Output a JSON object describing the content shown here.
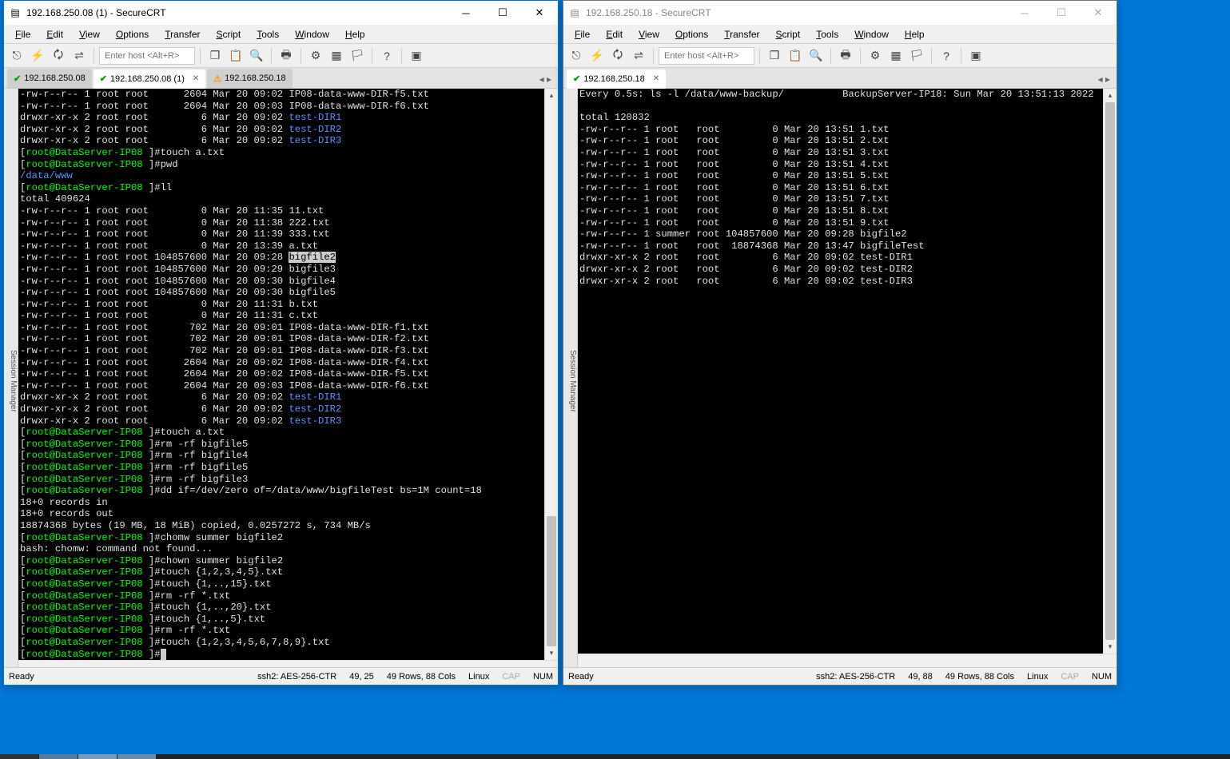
{
  "window1": {
    "title": "192.168.250.08 (1) - SecureCRT",
    "menus": [
      "File",
      "Edit",
      "View",
      "Options",
      "Transfer",
      "Script",
      "Tools",
      "Window",
      "Help"
    ],
    "host_placeholder": "Enter host <Alt+R>",
    "tabs": [
      {
        "label": "192.168.250.08",
        "icon": "check"
      },
      {
        "label": "192.168.250.08 (1)",
        "icon": "check",
        "active": true
      },
      {
        "label": "192.168.250.18",
        "icon": "warn"
      }
    ],
    "session_mgr_label": "Session Manager",
    "status": {
      "ready": "Ready",
      "conn": "ssh2: AES-256-CTR",
      "pos": "49,  25",
      "size": "49 Rows, 88 Cols",
      "os": "Linux",
      "caps": "CAP",
      "num": "NUM"
    },
    "prompt_user": "root@DataServer-IP08",
    "lines": [
      {
        "t": "file",
        "perm": "-rw-r--r--",
        "n": "1",
        "o": "root",
        "g": "root",
        "s": "2604",
        "d": "Mar 20 09:02",
        "f": "IP08-data-www-DIR-f5.txt"
      },
      {
        "t": "file",
        "perm": "-rw-r--r--",
        "n": "1",
        "o": "root",
        "g": "root",
        "s": "2604",
        "d": "Mar 20 09:03",
        "f": "IP08-data-www-DIR-f6.txt"
      },
      {
        "t": "dir",
        "perm": "drwxr-xr-x",
        "n": "2",
        "o": "root",
        "g": "root",
        "s": "6",
        "d": "Mar 20 09:02",
        "f": "test-DIR1"
      },
      {
        "t": "dir",
        "perm": "drwxr-xr-x",
        "n": "2",
        "o": "root",
        "g": "root",
        "s": "6",
        "d": "Mar 20 09:02",
        "f": "test-DIR2"
      },
      {
        "t": "dir",
        "perm": "drwxr-xr-x",
        "n": "2",
        "o": "root",
        "g": "root",
        "s": "6",
        "d": "Mar 20 09:02",
        "f": "test-DIR3"
      },
      {
        "t": "prompt",
        "cmd": "touch a.txt"
      },
      {
        "t": "prompt",
        "cmd": "pwd"
      },
      {
        "t": "out-blue",
        "text": "/data/www"
      },
      {
        "t": "prompt",
        "cmd": "ll"
      },
      {
        "t": "out",
        "text": "total 409624"
      },
      {
        "t": "file",
        "perm": "-rw-r--r--",
        "n": "1",
        "o": "root",
        "g": "root",
        "s": "0",
        "d": "Mar 20 11:35",
        "f": "11.txt"
      },
      {
        "t": "file",
        "perm": "-rw-r--r--",
        "n": "1",
        "o": "root",
        "g": "root",
        "s": "0",
        "d": "Mar 20 11:38",
        "f": "222.txt"
      },
      {
        "t": "file",
        "perm": "-rw-r--r--",
        "n": "1",
        "o": "root",
        "g": "root",
        "s": "0",
        "d": "Mar 20 11:39",
        "f": "333.txt"
      },
      {
        "t": "file",
        "perm": "-rw-r--r--",
        "n": "1",
        "o": "root",
        "g": "root",
        "s": "0",
        "d": "Mar 20 13:39",
        "f": "a.txt"
      },
      {
        "t": "file",
        "perm": "-rw-r--r--",
        "n": "1",
        "o": "root",
        "g": "root",
        "s": "104857600",
        "d": "Mar 20 09:28",
        "f": "bigfile2",
        "hl": true
      },
      {
        "t": "file",
        "perm": "-rw-r--r--",
        "n": "1",
        "o": "root",
        "g": "root",
        "s": "104857600",
        "d": "Mar 20 09:29",
        "f": "bigfile3"
      },
      {
        "t": "file",
        "perm": "-rw-r--r--",
        "n": "1",
        "o": "root",
        "g": "root",
        "s": "104857600",
        "d": "Mar 20 09:30",
        "f": "bigfile4"
      },
      {
        "t": "file",
        "perm": "-rw-r--r--",
        "n": "1",
        "o": "root",
        "g": "root",
        "s": "104857600",
        "d": "Mar 20 09:30",
        "f": "bigfile5"
      },
      {
        "t": "file",
        "perm": "-rw-r--r--",
        "n": "1",
        "o": "root",
        "g": "root",
        "s": "0",
        "d": "Mar 20 11:31",
        "f": "b.txt"
      },
      {
        "t": "file",
        "perm": "-rw-r--r--",
        "n": "1",
        "o": "root",
        "g": "root",
        "s": "0",
        "d": "Mar 20 11:31",
        "f": "c.txt"
      },
      {
        "t": "file",
        "perm": "-rw-r--r--",
        "n": "1",
        "o": "root",
        "g": "root",
        "s": "702",
        "d": "Mar 20 09:01",
        "f": "IP08-data-www-DIR-f1.txt"
      },
      {
        "t": "file",
        "perm": "-rw-r--r--",
        "n": "1",
        "o": "root",
        "g": "root",
        "s": "702",
        "d": "Mar 20 09:01",
        "f": "IP08-data-www-DIR-f2.txt"
      },
      {
        "t": "file",
        "perm": "-rw-r--r--",
        "n": "1",
        "o": "root",
        "g": "root",
        "s": "702",
        "d": "Mar 20 09:01",
        "f": "IP08-data-www-DIR-f3.txt"
      },
      {
        "t": "file",
        "perm": "-rw-r--r--",
        "n": "1",
        "o": "root",
        "g": "root",
        "s": "2604",
        "d": "Mar 20 09:02",
        "f": "IP08-data-www-DIR-f4.txt"
      },
      {
        "t": "file",
        "perm": "-rw-r--r--",
        "n": "1",
        "o": "root",
        "g": "root",
        "s": "2604",
        "d": "Mar 20 09:02",
        "f": "IP08-data-www-DIR-f5.txt"
      },
      {
        "t": "file",
        "perm": "-rw-r--r--",
        "n": "1",
        "o": "root",
        "g": "root",
        "s": "2604",
        "d": "Mar 20 09:03",
        "f": "IP08-data-www-DIR-f6.txt"
      },
      {
        "t": "dir",
        "perm": "drwxr-xr-x",
        "n": "2",
        "o": "root",
        "g": "root",
        "s": "6",
        "d": "Mar 20 09:02",
        "f": "test-DIR1"
      },
      {
        "t": "dir",
        "perm": "drwxr-xr-x",
        "n": "2",
        "o": "root",
        "g": "root",
        "s": "6",
        "d": "Mar 20 09:02",
        "f": "test-DIR2"
      },
      {
        "t": "dir",
        "perm": "drwxr-xr-x",
        "n": "2",
        "o": "root",
        "g": "root",
        "s": "6",
        "d": "Mar 20 09:02",
        "f": "test-DIR3"
      },
      {
        "t": "prompt",
        "cmd": "touch a.txt"
      },
      {
        "t": "prompt",
        "cmd": "rm -rf bigfile5"
      },
      {
        "t": "prompt",
        "cmd": "rm -rf bigfile4"
      },
      {
        "t": "prompt",
        "cmd": "rm -rf bigfile5"
      },
      {
        "t": "prompt",
        "cmd": "rm -rf bigfile3"
      },
      {
        "t": "prompt",
        "cmd": "dd if=/dev/zero of=/data/www/bigfileTest bs=1M count=18"
      },
      {
        "t": "out",
        "text": "18+0 records in"
      },
      {
        "t": "out",
        "text": "18+0 records out"
      },
      {
        "t": "out",
        "text": "18874368 bytes (19 MB, 18 MiB) copied, 0.0257272 s, 734 MB/s"
      },
      {
        "t": "prompt",
        "cmd": "chomw summer bigfile2"
      },
      {
        "t": "out",
        "text": "bash: chomw: command not found..."
      },
      {
        "t": "prompt",
        "cmd": "chown summer bigfile2"
      },
      {
        "t": "prompt",
        "cmd": "touch {1,2,3,4,5}.txt"
      },
      {
        "t": "prompt",
        "cmd": "touch {1,..,15}.txt"
      },
      {
        "t": "prompt",
        "cmd": "rm -rf *.txt"
      },
      {
        "t": "prompt",
        "cmd": "touch {1,..,20}.txt"
      },
      {
        "t": "prompt",
        "cmd": "touch {1,..,5}.txt"
      },
      {
        "t": "prompt",
        "cmd": "rm -rf *.txt"
      },
      {
        "t": "prompt",
        "cmd": "touch {1,2,3,4,5,6,7,8,9}.txt"
      },
      {
        "t": "prompt-cursor"
      }
    ]
  },
  "window2": {
    "title": "192.168.250.18 - SecureCRT",
    "menus": [
      "File",
      "Edit",
      "View",
      "Options",
      "Transfer",
      "Script",
      "Tools",
      "Window",
      "Help"
    ],
    "host_placeholder": "Enter host <Alt+R>",
    "tabs": [
      {
        "label": "192.168.250.18",
        "icon": "check",
        "active": true
      }
    ],
    "session_mgr_label": "Session Manager",
    "status": {
      "ready": "Ready",
      "conn": "ssh2: AES-256-CTR",
      "pos": "49, 88",
      "size": "49 Rows, 88 Cols",
      "os": "Linux",
      "caps": "CAP",
      "num": "NUM"
    },
    "header_left": "Every 0.5s: ls -l /data/www-backup/",
    "header_right": "BackupServer-IP18: Sun Mar 20 13:51:13 2022",
    "total": "total 120832",
    "rows": [
      {
        "perm": "-rw-r--r--",
        "n": "1",
        "o": "root",
        "g": "root",
        "s": "0",
        "d": "Mar 20 13:51",
        "f": "1.txt"
      },
      {
        "perm": "-rw-r--r--",
        "n": "1",
        "o": "root",
        "g": "root",
        "s": "0",
        "d": "Mar 20 13:51",
        "f": "2.txt"
      },
      {
        "perm": "-rw-r--r--",
        "n": "1",
        "o": "root",
        "g": "root",
        "s": "0",
        "d": "Mar 20 13:51",
        "f": "3.txt"
      },
      {
        "perm": "-rw-r--r--",
        "n": "1",
        "o": "root",
        "g": "root",
        "s": "0",
        "d": "Mar 20 13:51",
        "f": "4.txt"
      },
      {
        "perm": "-rw-r--r--",
        "n": "1",
        "o": "root",
        "g": "root",
        "s": "0",
        "d": "Mar 20 13:51",
        "f": "5.txt"
      },
      {
        "perm": "-rw-r--r--",
        "n": "1",
        "o": "root",
        "g": "root",
        "s": "0",
        "d": "Mar 20 13:51",
        "f": "6.txt"
      },
      {
        "perm": "-rw-r--r--",
        "n": "1",
        "o": "root",
        "g": "root",
        "s": "0",
        "d": "Mar 20 13:51",
        "f": "7.txt"
      },
      {
        "perm": "-rw-r--r--",
        "n": "1",
        "o": "root",
        "g": "root",
        "s": "0",
        "d": "Mar 20 13:51",
        "f": "8.txt"
      },
      {
        "perm": "-rw-r--r--",
        "n": "1",
        "o": "root",
        "g": "root",
        "s": "0",
        "d": "Mar 20 13:51",
        "f": "9.txt"
      },
      {
        "perm": "-rw-r--r--",
        "n": "1",
        "o": "summer",
        "g": "root",
        "s": "104857600",
        "d": "Mar 20 09:28",
        "f": "bigfile2"
      },
      {
        "perm": "-rw-r--r--",
        "n": "1",
        "o": "root",
        "g": "root",
        "s": "18874368",
        "d": "Mar 20 13:47",
        "f": "bigfileTest"
      },
      {
        "perm": "drwxr-xr-x",
        "n": "2",
        "o": "root",
        "g": "root",
        "s": "6",
        "d": "Mar 20 09:02",
        "f": "test-DIR1"
      },
      {
        "perm": "drwxr-xr-x",
        "n": "2",
        "o": "root",
        "g": "root",
        "s": "6",
        "d": "Mar 20 09:02",
        "f": "test-DIR2"
      },
      {
        "perm": "drwxr-xr-x",
        "n": "2",
        "o": "root",
        "g": "root",
        "s": "6",
        "d": "Mar 20 09:02",
        "f": "test-DIR3"
      }
    ]
  }
}
